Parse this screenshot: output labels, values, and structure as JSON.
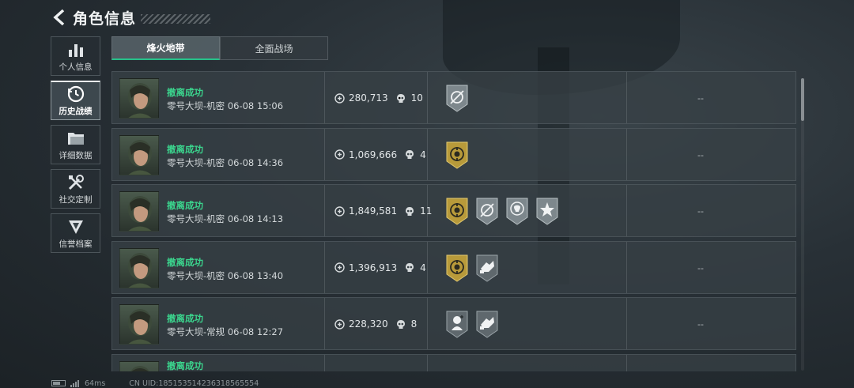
{
  "header": {
    "title": "角色信息"
  },
  "side_menu": [
    {
      "label": "个人信息",
      "icon": "bar-chart-icon",
      "active": false
    },
    {
      "label": "历史战绩",
      "icon": "history-clock-icon",
      "active": true
    },
    {
      "label": "详细数据",
      "icon": "folder-icon",
      "active": false
    },
    {
      "label": "社交定制",
      "icon": "tools-icon",
      "active": false
    },
    {
      "label": "信誉档案",
      "icon": "reputation-icon",
      "active": false
    }
  ],
  "tabs": [
    {
      "label": "烽火地带",
      "active": true
    },
    {
      "label": "全面战场",
      "active": false
    }
  ],
  "records": [
    {
      "status": "撤离成功",
      "map_mode": "零号大坝-机密",
      "datetime": "06-08 15:06",
      "value": "280,713",
      "kills": "10",
      "badges": [
        "crosshair-badge-icon"
      ],
      "extra": "--"
    },
    {
      "status": "撤离成功",
      "map_mode": "零号大坝-机密",
      "datetime": "06-08 14:36",
      "value": "1,069,666",
      "kills": "4",
      "badges": [
        "gold-emblem-badge-icon"
      ],
      "extra": "--"
    },
    {
      "status": "撤离成功",
      "map_mode": "零号大坝-机密",
      "datetime": "06-08 14:13",
      "value": "1,849,581",
      "kills": "11",
      "badges": [
        "gold-emblem-badge-icon",
        "crosshair-badge-icon",
        "skull-badge-icon",
        "star-badge-icon"
      ],
      "extra": "--"
    },
    {
      "status": "撤离成功",
      "map_mode": "零号大坝-机密",
      "datetime": "06-08 13:40",
      "value": "1,396,913",
      "kills": "4",
      "badges": [
        "gold-emblem-badge-icon",
        "hands-badge-icon"
      ],
      "extra": "--"
    },
    {
      "status": "撤离成功",
      "map_mode": "零号大坝-常规",
      "datetime": "06-08 12:27",
      "value": "228,320",
      "kills": "8",
      "badges": [
        "medic-badge-icon",
        "hands-badge-icon"
      ],
      "extra": "--"
    }
  ],
  "partial_record": {
    "status": "撤离成功"
  },
  "footer": {
    "ping": "64ms",
    "uid": "CN UID:185153514236318565554"
  },
  "colors": {
    "status_green": "#3bd48d",
    "gold_badge": "#b89a3a",
    "silver_badge": "#9aa3a8"
  }
}
